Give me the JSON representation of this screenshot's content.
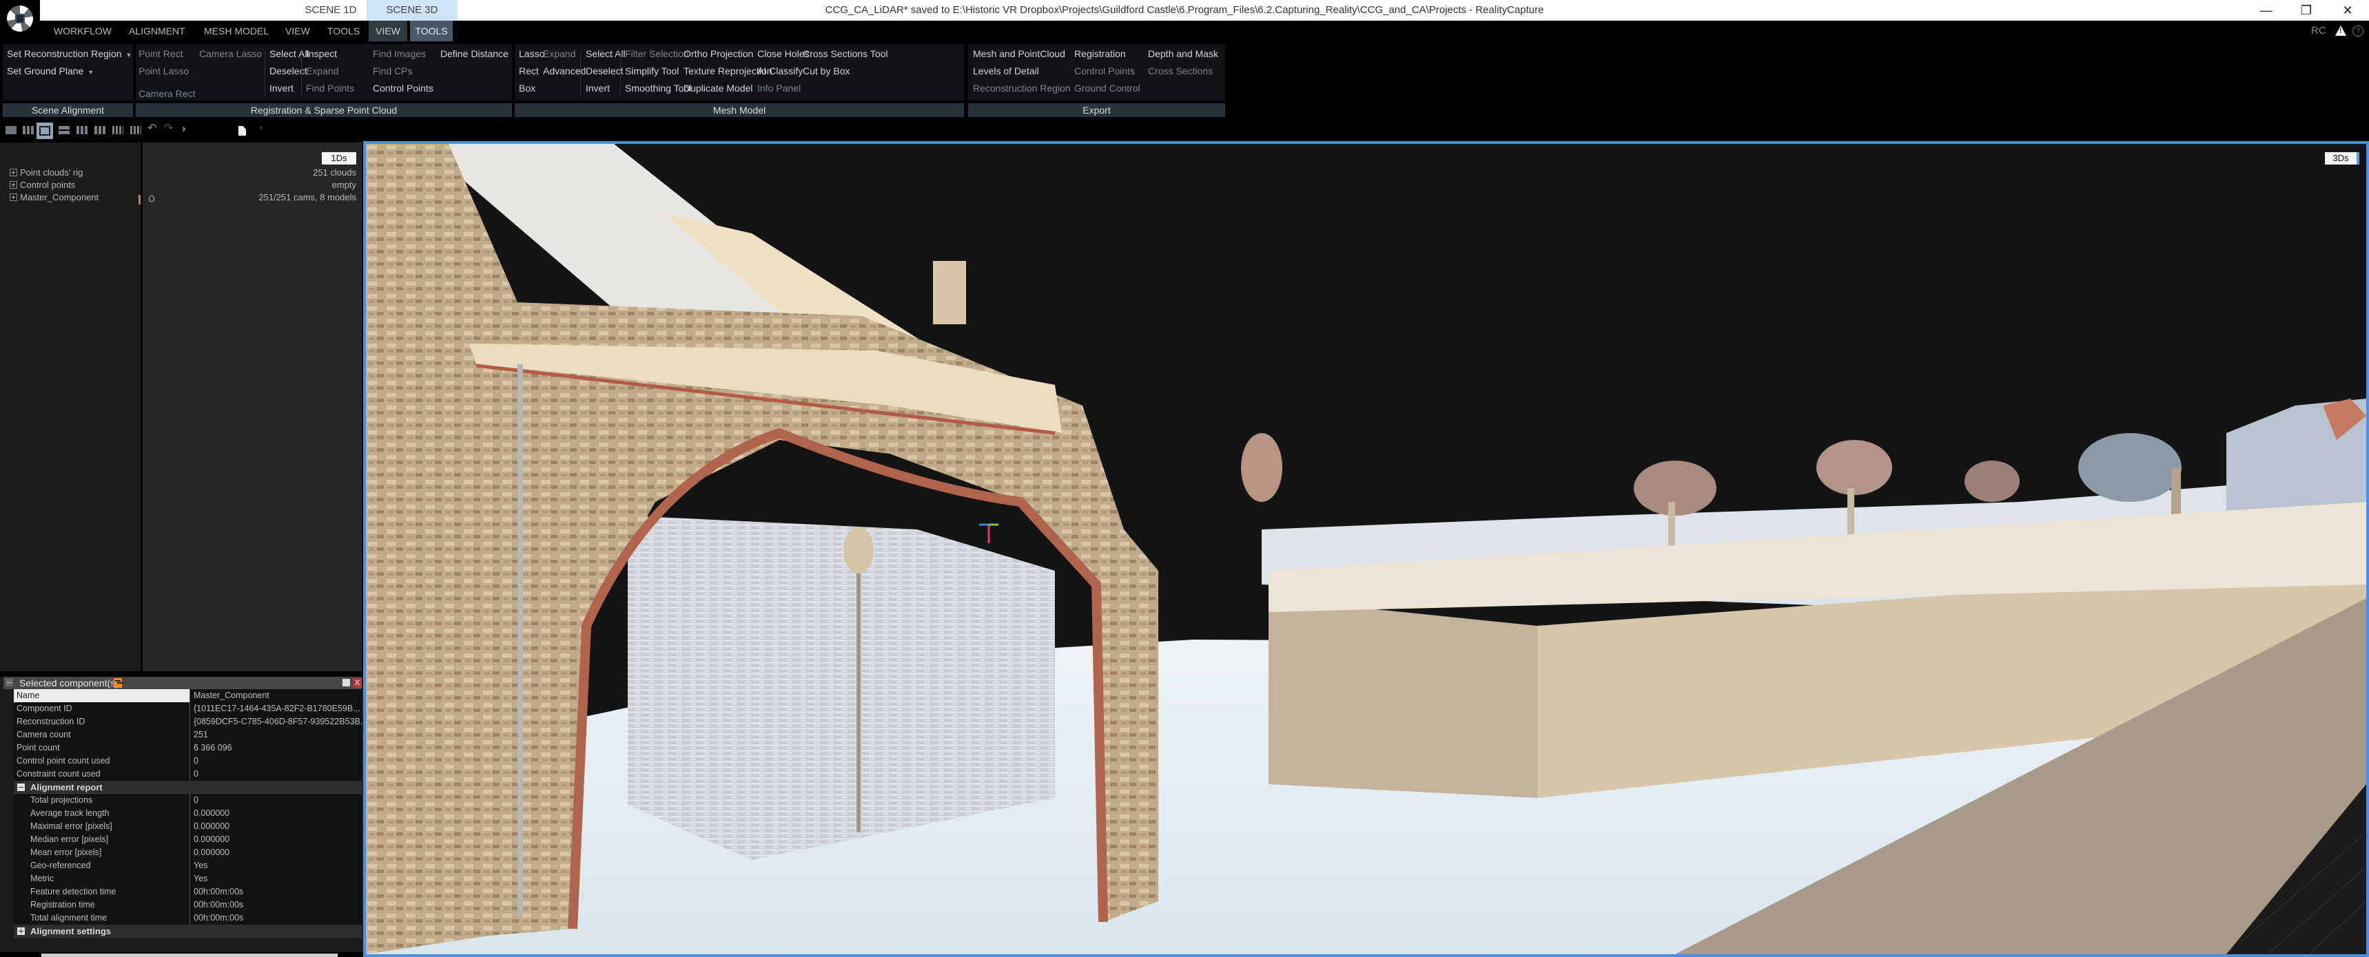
{
  "window": {
    "title": "CCG_CA_LiDAR* saved to E:\\Historic VR Dropbox\\Projects\\Guildford Castle\\6.Program_Files\\6.2.Capturing_Reality\\CCG_and_CA\\Projects - RealityCapture",
    "scene_tabs": [
      "SCENE 1D",
      "SCENE 3D"
    ],
    "controls": {
      "minimize": "—",
      "maximize": "❐",
      "close": "✕"
    }
  },
  "menu": {
    "items": [
      "WORKFLOW",
      "ALIGNMENT",
      "MESH MODEL",
      "VIEW",
      "TOOLS",
      "VIEW",
      "TOOLS"
    ],
    "right_label": "RC",
    "help": "?"
  },
  "ribbon": {
    "scene_alignment": {
      "label": "Scene Alignment",
      "items": [
        "Set Reconstruction Region",
        "Set Ground Plane"
      ]
    },
    "registration": {
      "label": "Registration & Sparse Point Cloud",
      "items": [
        "Point Rect",
        "Camera Lasso",
        "Point Lasso",
        "Camera Rect",
        "Select All",
        "Deselect",
        "Invert",
        "Inspect",
        "Expand",
        "Find Points",
        "Find Images",
        "Find CPs",
        "Control Points",
        "Define Distance"
      ]
    },
    "mesh_model": {
      "label": "Mesh Model",
      "items": [
        "Lasso",
        "Expand",
        "Rect",
        "Advanced",
        "Box",
        "Select All",
        "Deselect",
        "Invert",
        "Filter Selection",
        "Simplify Tool",
        "Smoothing Tool",
        "Ortho Projection",
        "Texture Reprojection",
        "Duplicate Model",
        "Close Holes",
        "AI Classify",
        "Info Panel",
        "Cross Sections Tool",
        "Cut by Box"
      ]
    },
    "export": {
      "label": "Export",
      "items": [
        "Mesh and PointCloud",
        "Levels of Detail",
        "Reconstruction Region",
        "Registration",
        "Control Points",
        "Ground Control",
        "Depth and Mask",
        "Cross Sections"
      ]
    }
  },
  "tree": {
    "badge": "1Ds",
    "rows": [
      {
        "label": "Point clouds' rig",
        "value": "251 clouds"
      },
      {
        "label": "Control points",
        "value": "empty"
      },
      {
        "label": "Master_Component",
        "value": "251/251 cams, 8 models"
      }
    ]
  },
  "component_panel": {
    "title": "Selected component(s)",
    "close": "X",
    "properties": [
      {
        "name": "Name",
        "value": "Master_Component"
      },
      {
        "name": "Component ID",
        "value": "{1011EC17-1464-435A-82F2-B1780E59B..."
      },
      {
        "name": "Reconstruction ID",
        "value": "{0859DCF5-C785-406D-8F57-939522B53B..."
      },
      {
        "name": "Camera count",
        "value": "251"
      },
      {
        "name": "Point count",
        "value": "6 366 096"
      },
      {
        "name": "Control point count used",
        "value": "0"
      },
      {
        "name": "Constraint count used",
        "value": "0"
      }
    ],
    "alignment_report": {
      "label": "Alignment report",
      "rows": [
        {
          "name": "Total projections",
          "value": "0"
        },
        {
          "name": "Average track length",
          "value": "0.000000"
        },
        {
          "name": "Maximal error [pixels]",
          "value": "0.000000"
        },
        {
          "name": "Median error [pixels]",
          "value": "0.000000"
        },
        {
          "name": "Mean error [pixels]",
          "value": "0.000000"
        },
        {
          "name": "Geo-referenced",
          "value": "Yes"
        },
        {
          "name": "Metric",
          "value": "Yes"
        },
        {
          "name": "Feature detection time",
          "value": "00h:00m:00s"
        },
        {
          "name": "Registration time",
          "value": "00h:00m:00s"
        },
        {
          "name": "Total alignment time",
          "value": "00h:00m:00s"
        }
      ]
    },
    "alignment_settings": {
      "label": "Alignment settings"
    }
  },
  "viewport": {
    "badge": "3Ds",
    "accent": "#4a8fe0"
  },
  "colors": {
    "accent_blue": "#4a8fe0",
    "scene_tab_active": "#cde4f7",
    "pin_orange": "#f08a30",
    "close_red": "#b33333"
  }
}
